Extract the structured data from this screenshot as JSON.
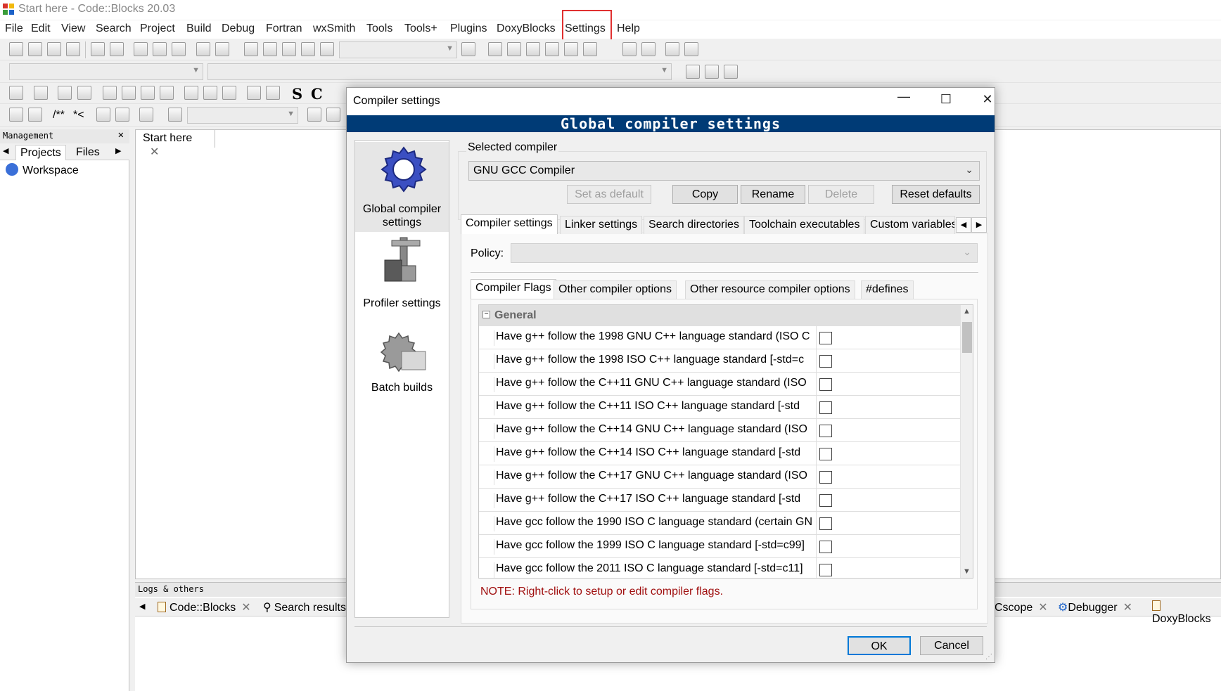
{
  "window": {
    "title": "Start here - Code::Blocks 20.03"
  },
  "menu": [
    "File",
    "Edit",
    "View",
    "Search",
    "Project",
    "Build",
    "Debug",
    "Fortran",
    "wxSmith",
    "Tools",
    "Tools+",
    "Plugins",
    "DoxyBlocks",
    "Settings",
    "Help"
  ],
  "toolbar": {
    "comment_start": "/**",
    "comment_inline": "*<",
    "letter_s": "S",
    "letter_c": "C"
  },
  "management": {
    "title": "Management",
    "tabs": [
      "Projects",
      "Files"
    ],
    "workspace": "Workspace"
  },
  "editor": {
    "tab_label": "Start here"
  },
  "logs": {
    "title": "Logs & others",
    "tabs": [
      "Code::Blocks",
      "Search results",
      "Cscope",
      "Debugger",
      "DoxyBlocks"
    ]
  },
  "dialog": {
    "title": "Compiler settings",
    "banner": "Global compiler settings",
    "sidebar": [
      {
        "label": "Global compiler settings",
        "icon": "gear-icon",
        "selected": true
      },
      {
        "label": "Profiler settings",
        "icon": "caliper-icon",
        "selected": false
      },
      {
        "label": "Batch builds",
        "icon": "batch-gear-icon",
        "selected": false
      }
    ],
    "selected_compiler_label": "Selected compiler",
    "selected_compiler": "GNU GCC Compiler",
    "compiler_buttons": {
      "set_default": "Set as default",
      "copy": "Copy",
      "rename": "Rename",
      "delete": "Delete",
      "reset": "Reset defaults"
    },
    "tabs": [
      "Compiler settings",
      "Linker settings",
      "Search directories",
      "Toolchain executables",
      "Custom variables"
    ],
    "policy_label": "Policy:",
    "policy_value": "",
    "subtabs": [
      "Compiler Flags",
      "Other compiler options",
      "Other resource compiler options",
      "#defines"
    ],
    "flags_group": "General",
    "flags": [
      "Have g++ follow the 1998 GNU C++ language standard (ISO C",
      "Have g++ follow the 1998 ISO C++ language standard  [-std=c",
      "Have g++ follow the C++11 GNU C++ language standard (ISO",
      "Have g++ follow the C++11 ISO C++ language standard  [-std",
      "Have g++ follow the C++14 GNU C++ language standard (ISO",
      "Have g++ follow the C++14 ISO C++ language standard  [-std",
      "Have g++ follow the C++17 GNU C++ language standard (ISO",
      "Have g++ follow the C++17 ISO C++ language standard  [-std",
      "Have gcc follow the 1990 ISO C language standard  (certain GN",
      "Have gcc follow the 1999 ISO C language standard  [-std=c99]",
      "Have gcc follow the 2011 ISO C language standard  [-std=c11]"
    ],
    "note": "NOTE: Right-click to setup or edit compiler flags.",
    "ok": "OK",
    "cancel": "Cancel"
  },
  "colors": {
    "banner": "#003b76",
    "highlight": "#e03030",
    "note": "#a01010"
  }
}
